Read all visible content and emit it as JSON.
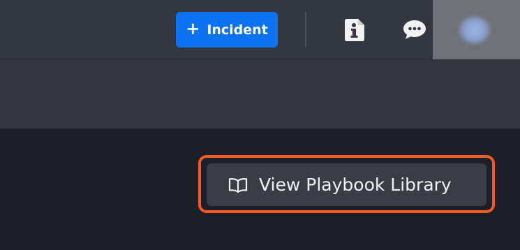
{
  "header": {
    "incident_button": {
      "icon": "plus-icon",
      "label": "Incident"
    },
    "info_button": {
      "icon": "info-document-icon"
    },
    "chat_button": {
      "icon": "chat-bubble-icon"
    },
    "avatar": {
      "icon": "user-avatar"
    }
  },
  "main": {
    "playbook_button": {
      "icon": "open-book-icon",
      "label": "View Playbook Library"
    }
  },
  "colors": {
    "primary_blue": "#0d72f0",
    "highlight_orange": "#f25a22",
    "topbar_bg": "#33373f",
    "main_bg": "#1c1f27"
  }
}
